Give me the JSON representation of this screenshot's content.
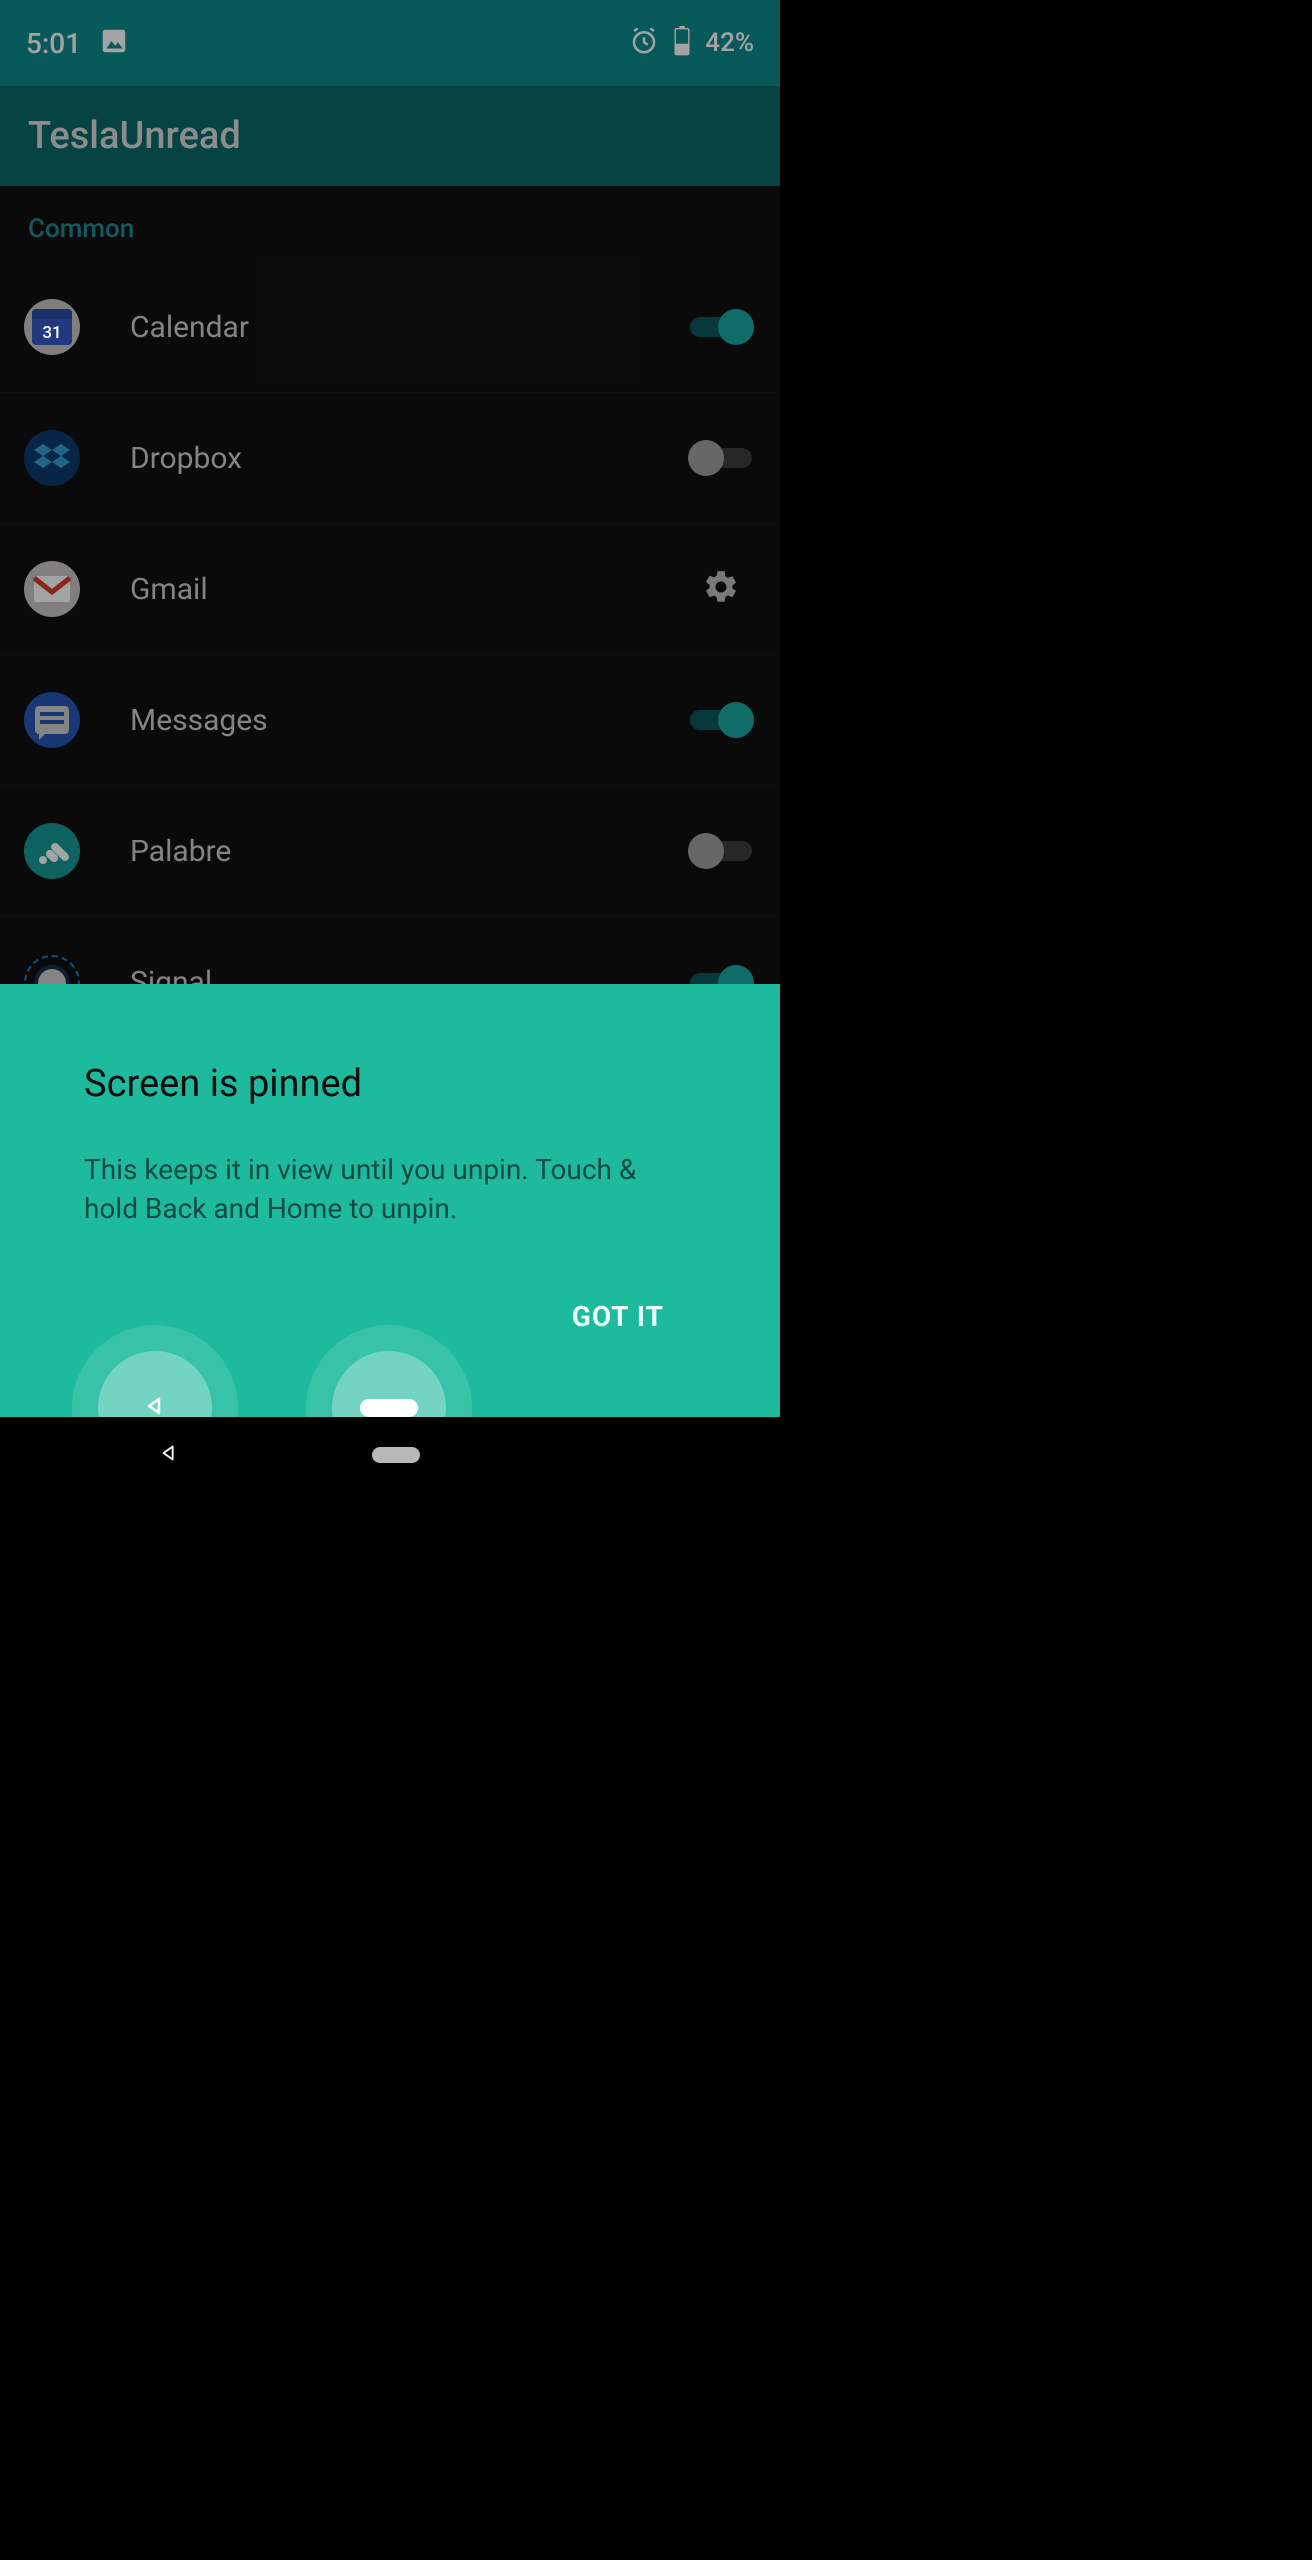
{
  "status": {
    "time": "5:01",
    "battery_pct": "42%"
  },
  "header": {
    "title": "TeslaUnread"
  },
  "section": {
    "label": "Common"
  },
  "apps": [
    {
      "name": "Calendar",
      "icon": "calendar-icon",
      "enabled": true,
      "trailing": "switch",
      "badge": "31"
    },
    {
      "name": "Dropbox",
      "icon": "dropbox-icon",
      "enabled": false,
      "trailing": "switch"
    },
    {
      "name": "Gmail",
      "icon": "gmail-icon",
      "enabled": null,
      "trailing": "gear"
    },
    {
      "name": "Messages",
      "icon": "messages-icon",
      "enabled": true,
      "trailing": "switch"
    },
    {
      "name": "Palabre",
      "icon": "palabre-icon",
      "enabled": false,
      "trailing": "switch"
    },
    {
      "name": "Signal",
      "icon": "signal-icon",
      "enabled": true,
      "trailing": "switch"
    }
  ],
  "pin": {
    "title": "Screen is pinned",
    "body": "This keeps it in view until you unpin. Touch & hold Back and Home to unpin.",
    "confirm": "GOT IT"
  }
}
